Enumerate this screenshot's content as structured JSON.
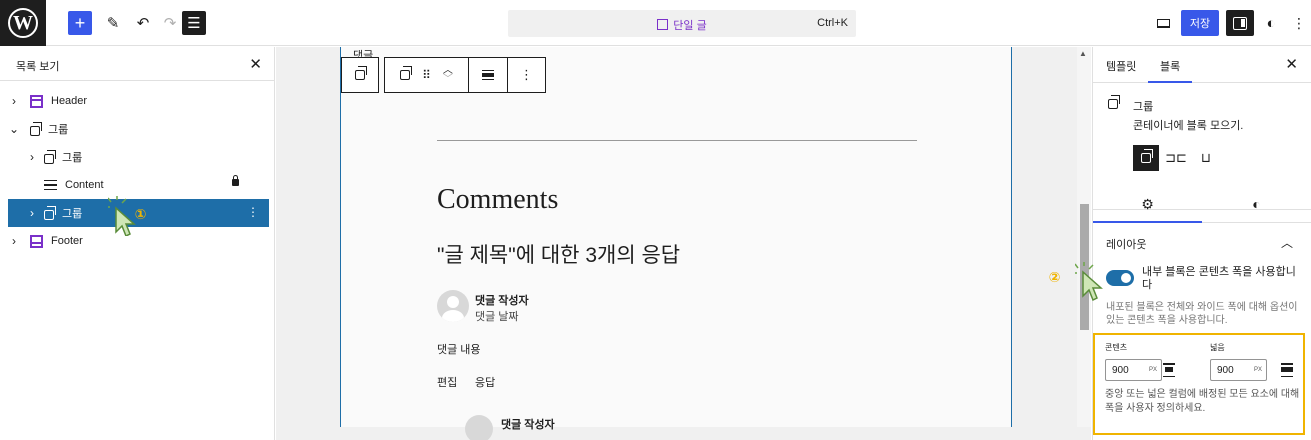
{
  "topbar": {
    "logo": "W",
    "cmd_title": "단일 글",
    "cmd_shortcut": "Ctrl+K",
    "save_label": "저장"
  },
  "listview": {
    "title": "목록 보기",
    "items": [
      {
        "label": "Header",
        "icon": "header-template-icon"
      },
      {
        "label": "그룹",
        "icon": "group-icon"
      },
      {
        "label": "그룹",
        "icon": "group-icon"
      },
      {
        "label": "Content",
        "icon": "post-content-icon"
      },
      {
        "label": "그룹",
        "icon": "group-icon"
      },
      {
        "label": "Footer",
        "icon": "footer-template-icon"
      }
    ]
  },
  "steps": {
    "one": "①",
    "two": "②"
  },
  "canvas": {
    "block_label": "댓글",
    "comments_heading": "Comments",
    "responses_heading": "\"글 제목\"에 대한 3개의 응답",
    "author": "댓글 작성자",
    "date": "댓글 날짜",
    "content": "댓글 내용",
    "edit": "편집",
    "reply": "응답",
    "author2": "댓글 작성자"
  },
  "sidebar": {
    "tab_template": "템플릿",
    "tab_block": "블록",
    "block_name": "그룹",
    "block_desc": "콘테이너에 블록 모으기.",
    "layout_heading": "레이아웃",
    "toggle_label": "내부 블록은 콘텐츠 폭을 사용합니다",
    "toggle_help": "내포된 블록은 전체와 와이드 폭에 대해 옵션이 있는 콘텐츠 폭을 사용합니다.",
    "content_label": "콘텐츠",
    "wide_label": "넓음",
    "content_value": "900",
    "wide_value": "900",
    "unit": "PX",
    "width_help": "중앙 또는 넓은 컬럼에 배정된 모든 요소에 대해 폭을 사용자 정의하세요."
  },
  "colors": {
    "accent": "#3858e9",
    "selected": "#1e6ea8",
    "highlight": "#f0b400",
    "template": "#7a30c9"
  }
}
